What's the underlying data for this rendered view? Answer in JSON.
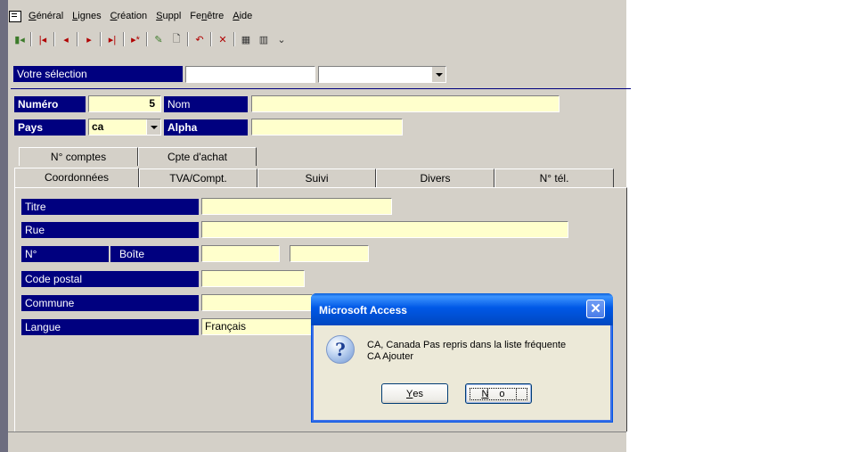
{
  "menu": {
    "items": [
      {
        "label": "Général",
        "ul": "G",
        "rest": "énéral"
      },
      {
        "label": "Lignes",
        "ul": "L",
        "rest": "ignes"
      },
      {
        "label": "Création",
        "ul": "C",
        "rest": "réation"
      },
      {
        "label": "Suppl",
        "ul": "S",
        "rest": "uppl"
      },
      {
        "label": "Fenêtre",
        "pre": "Fe",
        "ul": "n",
        "rest": "être"
      },
      {
        "label": "Aide",
        "ul": "A",
        "rest": "ide"
      }
    ]
  },
  "selection": {
    "label": "Votre sélection",
    "field1_value": "",
    "field2_value": ""
  },
  "record": {
    "numero_label": "Numéro",
    "numero_value": "5",
    "nom_label": "Nom",
    "nom_value": "",
    "pays_label": "Pays",
    "pays_value": "ca",
    "alpha_label": "Alpha",
    "alpha_value": ""
  },
  "tabs": {
    "row_back": [
      "N° comptes",
      "Cpte d'achat"
    ],
    "row_front": [
      "Coordonnées",
      "TVA/Compt.",
      "Suivi",
      "Divers",
      "N° tél."
    ]
  },
  "form": {
    "titre_label": "Titre",
    "titre_value": "",
    "rue_label": "Rue",
    "rue_value": "",
    "no_label": "N°",
    "boite_label": "Boîte",
    "no_value": "",
    "boite_value": "",
    "code_postal_label": "Code postal",
    "code_postal_value": "",
    "commune_label": "Commune",
    "commune_value": "",
    "langue_label": "Langue",
    "langue_value": "Français"
  },
  "dialog": {
    "title": "Microsoft Access",
    "message_line1": "CA, Canada Pas repris dans la liste fréquente",
    "message_line2": "CA Ajouter",
    "yes_label": "Yes",
    "yes_ul": "Y",
    "yes_rest": "es",
    "no_label": "No",
    "no_ul": "N",
    "no_rest": "o",
    "close_glyph": "✕",
    "icon": "question-icon"
  },
  "colors": {
    "label_bg": "#00007f",
    "field_bg": "#ffffcc",
    "app_bg": "#d4d0c8",
    "dialog_title": "#0058e6"
  }
}
